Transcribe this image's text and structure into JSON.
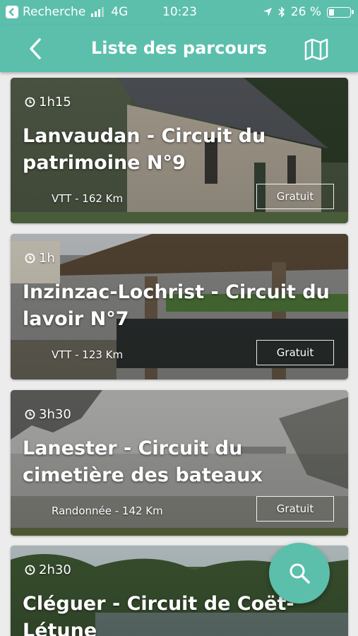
{
  "status_bar": {
    "carrier": "Recherche",
    "network": "4G",
    "time": "10:23",
    "battery": "26 %",
    "battery_level": 0.26
  },
  "header": {
    "title": "Liste des parcours",
    "back_icon": "chevron-left-icon",
    "map_icon": "map-icon"
  },
  "routes": [
    {
      "duration": "1h15",
      "title": "Lanvaudan - Circuit du patrimoine N°9",
      "meta": "VTT - 162 Km",
      "price": "Gratuit"
    },
    {
      "duration": "1h",
      "title": "Inzinzac-Lochrist - Circuit du lavoir N°7",
      "meta": "VTT - 123 Km",
      "price": "Gratuit"
    },
    {
      "duration": "3h30",
      "title": "Lanester - Circuit du cimetière des bateaux",
      "meta": "Randonnée - 142 Km",
      "price": "Gratuit"
    },
    {
      "duration": "2h30",
      "title": "Cléguer - Circuit de Coët-Létune",
      "meta": "",
      "price": ""
    }
  ],
  "fab": {
    "icon": "search-icon"
  },
  "colors": {
    "accent": "#5bbfac"
  }
}
